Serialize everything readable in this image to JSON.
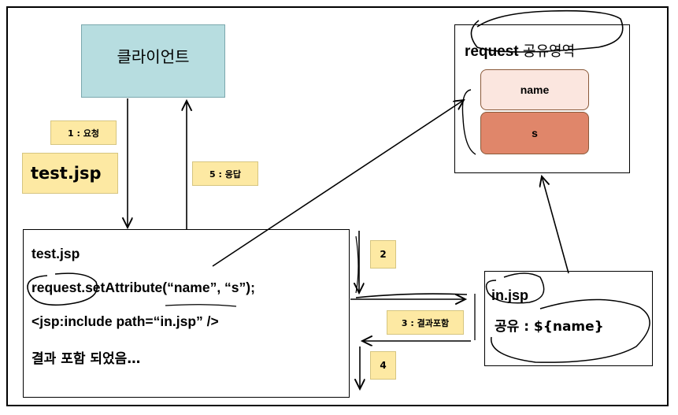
{
  "client": {
    "label": "클라이언트"
  },
  "steps": {
    "step1": "1 : 요청",
    "step2": "2",
    "step3": "3 : 결과포함",
    "step4": "4",
    "step5": "5 : 응답"
  },
  "test_label": "test.jsp",
  "code": {
    "line1": "test.jsp",
    "line2": "request.setAttribute(“name”, “s”);",
    "line3": "<jsp:include path=“in.jsp” />",
    "line4": "결과 포함 되었음…"
  },
  "shared": {
    "title_en": "request",
    "title_ko": "공유영역",
    "attr_name": "name",
    "attr_value": "s"
  },
  "in_jsp": {
    "title": "in.jsp",
    "share": "공유 : ${name}"
  }
}
